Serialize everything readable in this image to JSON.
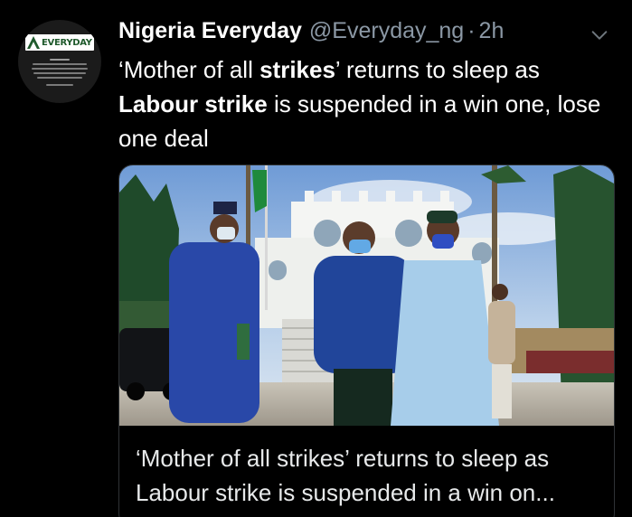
{
  "tweet": {
    "author": {
      "display_name": "Nigeria Everyday",
      "handle": "@Everyday_ng",
      "avatar_logo_text": "EVERYDAY"
    },
    "separator": "·",
    "time": "2h",
    "text": {
      "p1": "‘Mother of all ",
      "b1": "strikes",
      "p2": "’ returns to sleep as ",
      "b2": "Labour strike",
      "p3": " is suspended in a win one, lose one deal"
    },
    "card": {
      "image_alt": "Three men in blue attire walking down from a white government building",
      "title": "‘Mother of all strikes’ returns to sleep as Labour strike is suspended in a win on..."
    },
    "icons": {
      "more": "chevron-down-icon"
    },
    "colors": {
      "background": "#000000",
      "primary_text": "#ffffff",
      "secondary_text": "#8b98a5",
      "card_border": "#2f3336"
    }
  }
}
